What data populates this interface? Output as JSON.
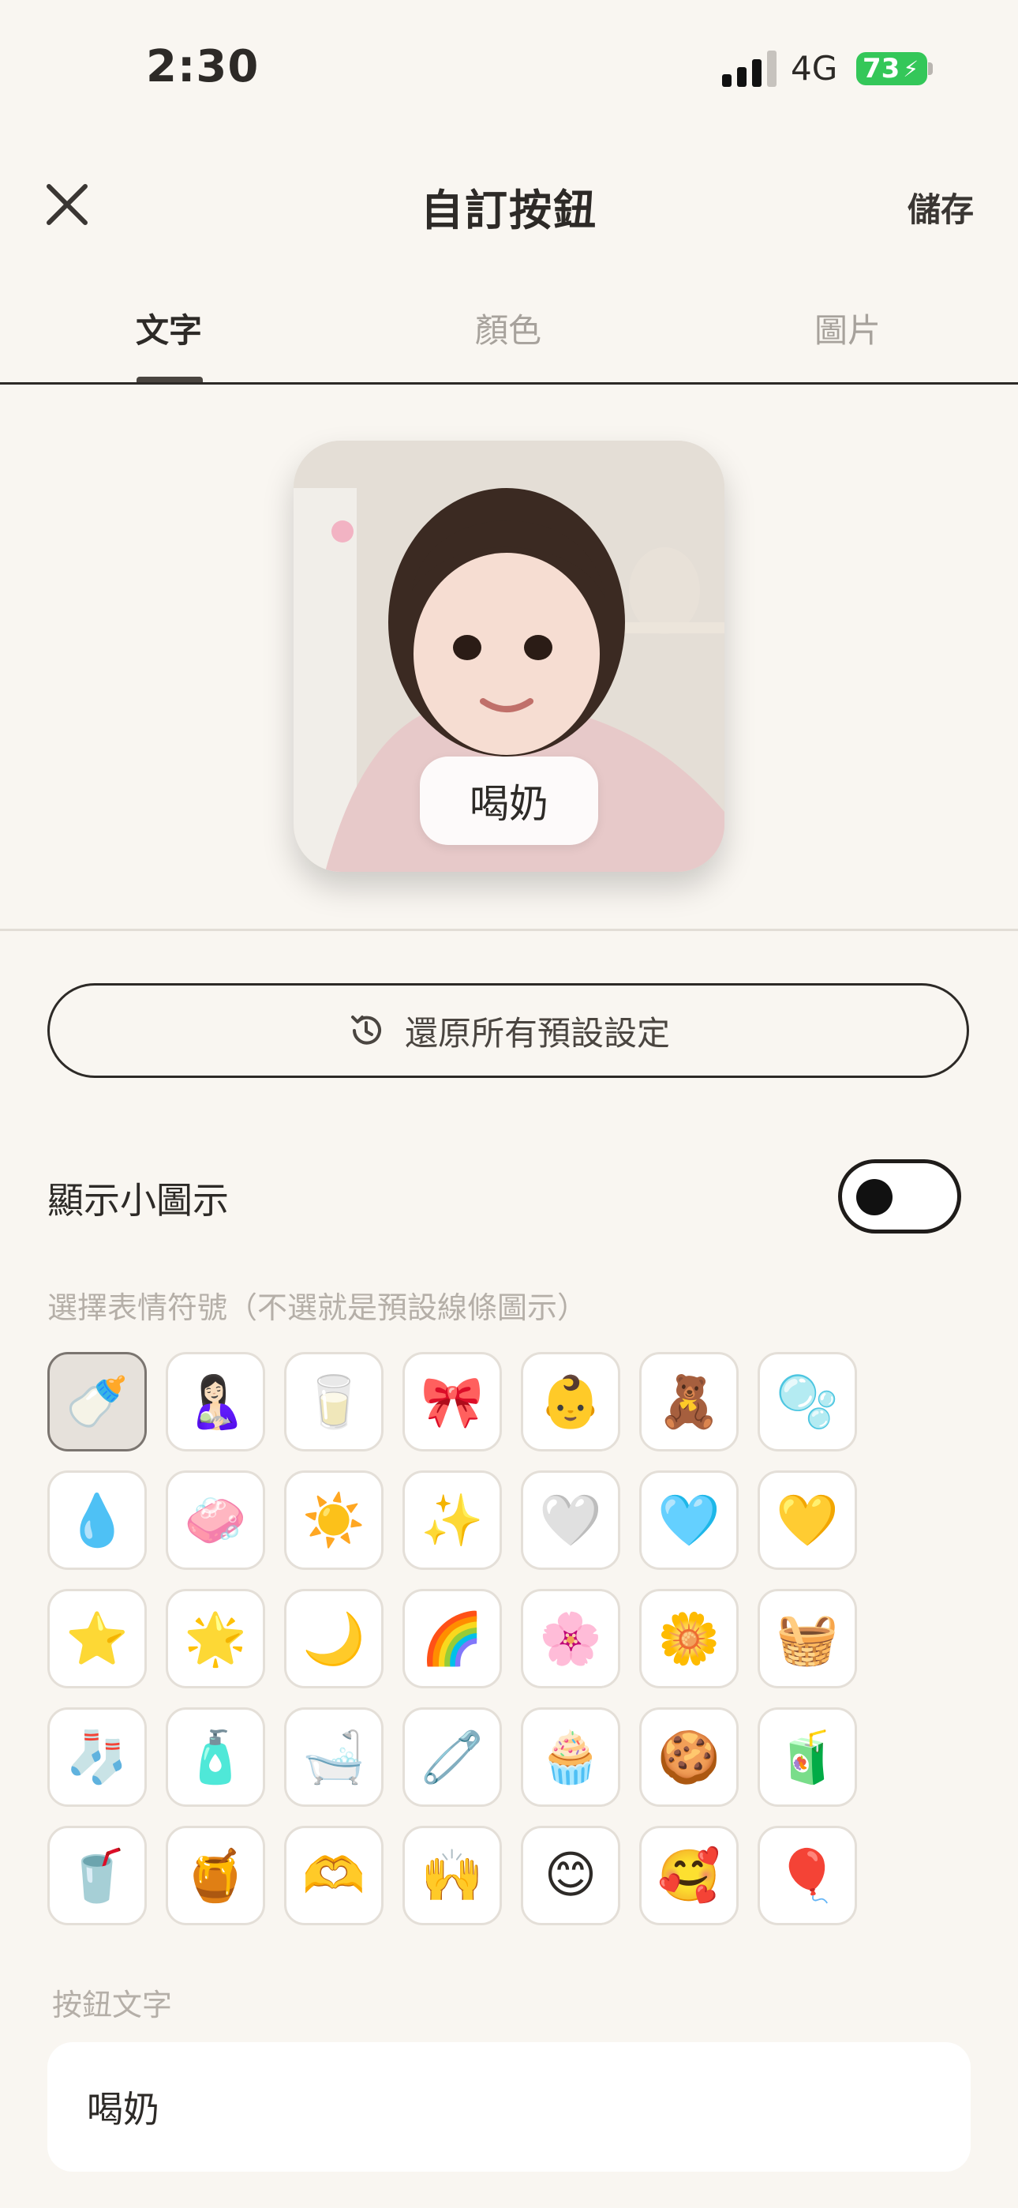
{
  "status_bar": {
    "time": "2:30",
    "network": "4G",
    "battery": "73"
  },
  "header": {
    "title": "自訂按鈕",
    "save_label": "儲存",
    "close_icon": "close-icon"
  },
  "tabs": [
    {
      "label": "文字",
      "active": true
    },
    {
      "label": "顏色",
      "active": false
    },
    {
      "label": "圖片",
      "active": false
    }
  ],
  "preview": {
    "label": "喝奶"
  },
  "reset_button": {
    "label": "還原所有預設設定",
    "icon": "history-icon"
  },
  "toggle": {
    "label": "顯示小圖示",
    "on": false
  },
  "emoji_section": {
    "hint": "選擇表情符號（不選就是預設線條圖示）",
    "selected_index": 0,
    "emojis": [
      "🍼",
      "🤱🏻",
      "🥛",
      "🎀",
      "👶",
      "🧸",
      "🫧",
      "💧",
      "🧼",
      "☀️",
      "✨",
      "🤍",
      "🩵",
      "💛",
      "⭐",
      "🌟",
      "🌙",
      "🌈",
      "🌸",
      "🌼",
      "🧺",
      "🧦",
      "🧴",
      "🛁",
      "🧷",
      "🧁",
      "🍪",
      "🧃",
      "🥤",
      "🍯",
      "🫶",
      "🙌",
      "😊",
      "🥰",
      "🎈"
    ]
  },
  "text_field": {
    "label": "按鈕文字",
    "value": "喝奶"
  },
  "colors": {
    "background": "#f9f6f1",
    "battery": "#34c759",
    "border": "#2d2a27"
  }
}
